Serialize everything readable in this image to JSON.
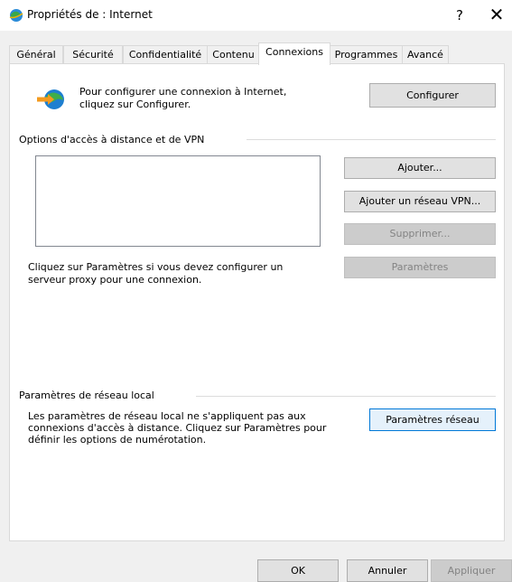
{
  "window": {
    "title": "Propriétés de : Internet",
    "help": "?",
    "close": "✕"
  },
  "tabs": [
    {
      "label": "Général"
    },
    {
      "label": "Sécurité"
    },
    {
      "label": "Confidentialité"
    },
    {
      "label": "Contenu"
    },
    {
      "label": "Connexions"
    },
    {
      "label": "Programmes"
    },
    {
      "label": "Avancé"
    }
  ],
  "active_tab": "Connexions",
  "setup": {
    "text": "Pour configurer une connexion à Internet, cliquez sur Configurer.",
    "button": "Configurer"
  },
  "dialup": {
    "group_title": "Options d'accès à distance et de VPN",
    "add_button": "Ajouter...",
    "add_vpn_button": "Ajouter un réseau VPN...",
    "remove_button": "Supprimer...",
    "settings_button": "Paramètres",
    "proxy_text": "Cliquez sur Paramètres si vous devez configurer un serveur proxy pour une connexion."
  },
  "lan": {
    "group_title": "Paramètres de réseau local",
    "text": "Les paramètres de réseau local ne s'appliquent pas aux connexions d'accès à distance. Cliquez sur Paramètres pour définir les options de numérotation.",
    "button": "Paramètres réseau"
  },
  "footer": {
    "ok": "OK",
    "cancel": "Annuler",
    "apply": "Appliquer"
  },
  "colors": {
    "focus_border": "#0078d7",
    "panel_bg": "#ffffff",
    "window_bg": "#f0f0f0"
  },
  "icons": {
    "app": "internet-options-globe-icon",
    "connection": "network-globe-arrow-icon"
  }
}
